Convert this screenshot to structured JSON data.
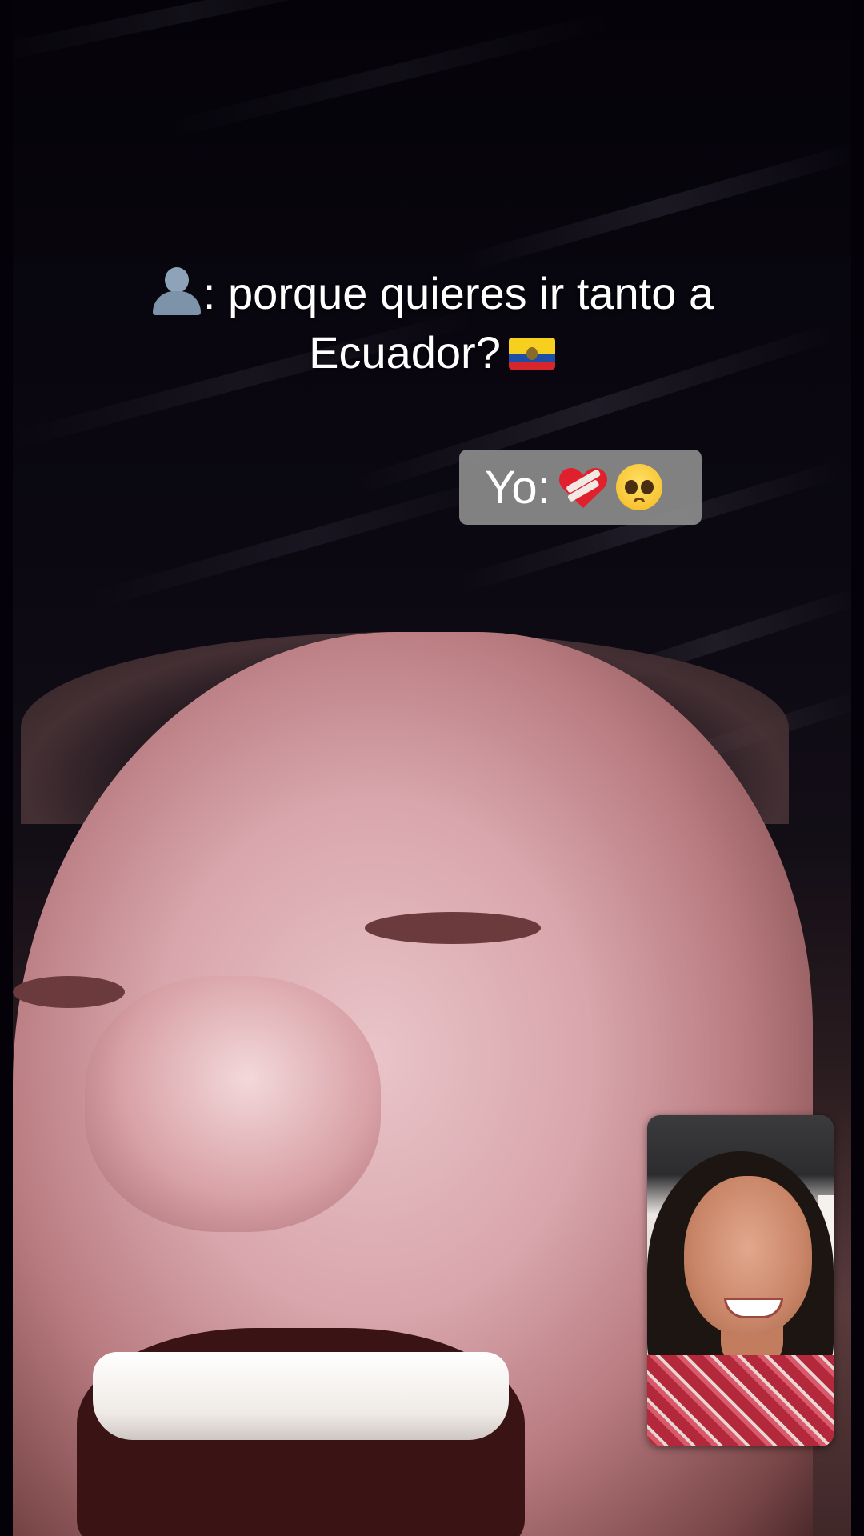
{
  "call": {
    "caption": {
      "person_icon": "bust-in-silhouette-icon",
      "text": ": porque quieres ir tanto a Ecuador?",
      "flag_icon": "ecuador-flag-icon"
    },
    "reply": {
      "label": "Yo:",
      "emojis": [
        "mending-heart-icon",
        "pleading-face-icon"
      ],
      "bubble_color": "#8c8c8c"
    }
  },
  "colors": {
    "caption_text": "#ffffff",
    "background": "#040208"
  }
}
